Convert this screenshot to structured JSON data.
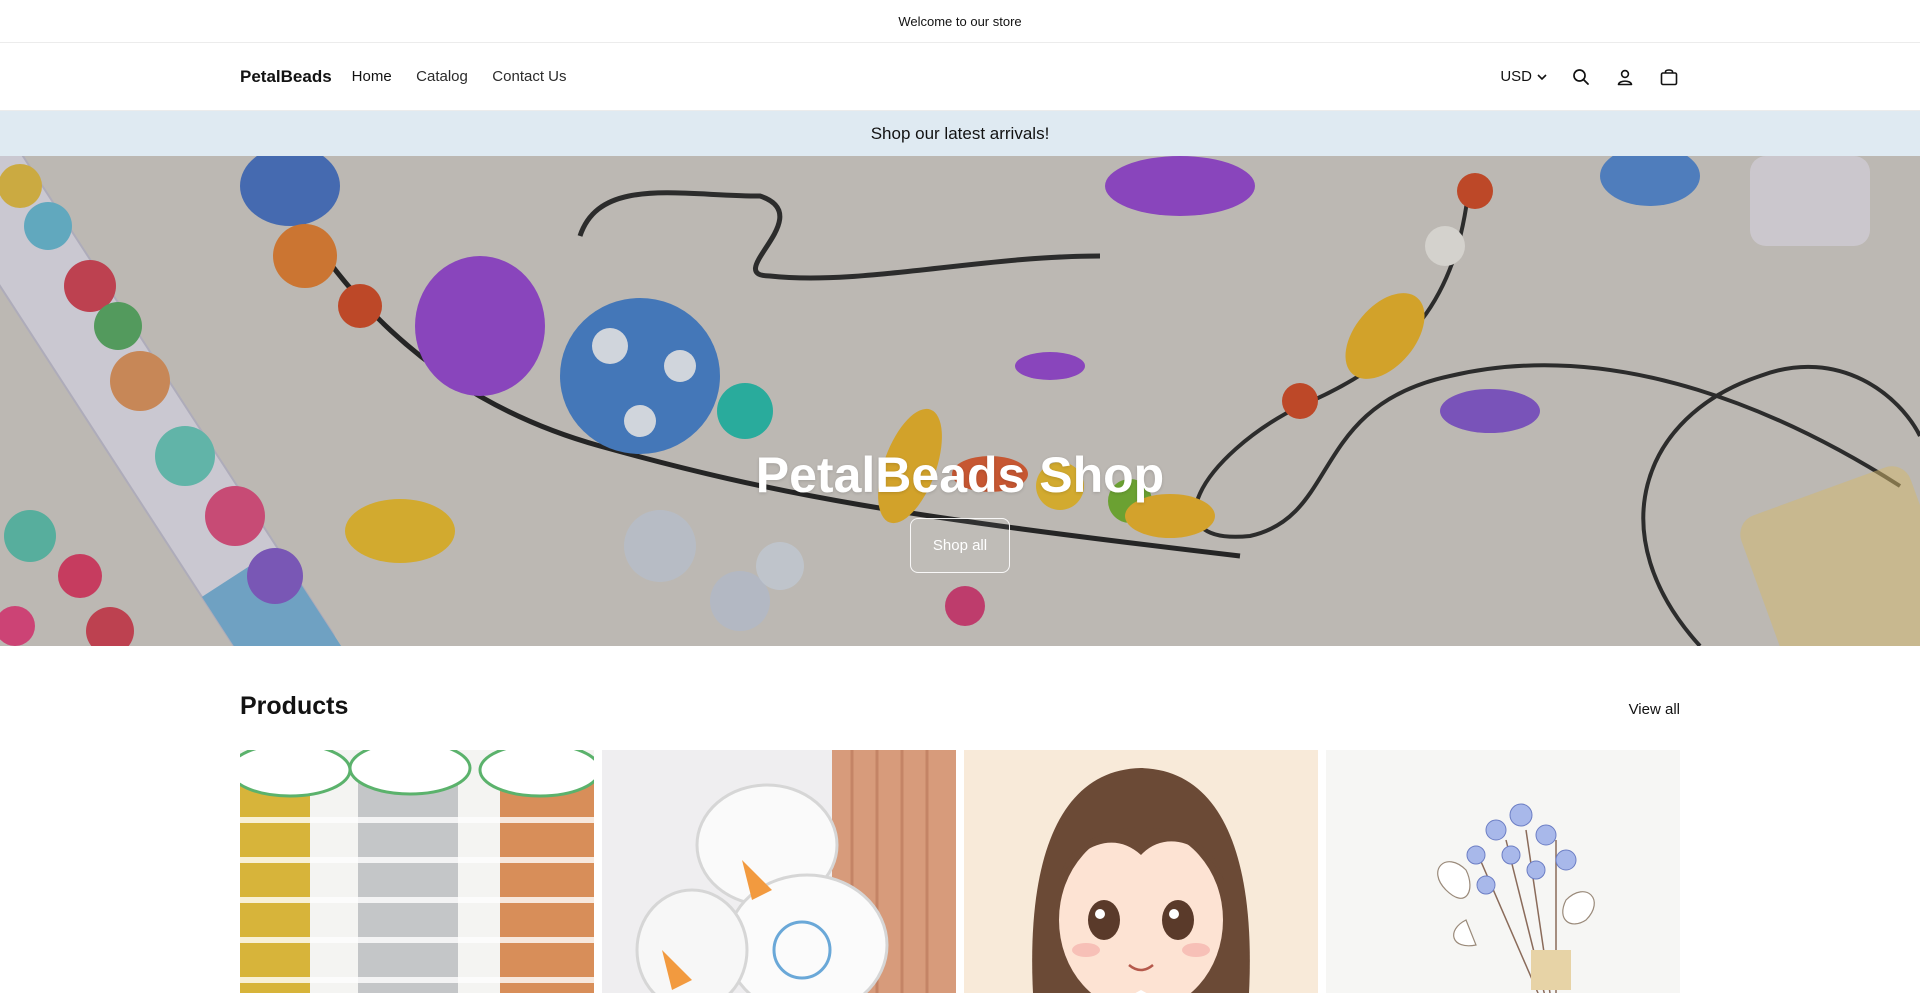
{
  "announcement": {
    "text": "Welcome to our store"
  },
  "header": {
    "logo": "PetalBeads",
    "nav": [
      "Home",
      "Catalog",
      "Contact Us"
    ],
    "currency": "USD",
    "icons": [
      "chevron-down-icon",
      "search-icon",
      "account-icon",
      "cart-icon"
    ]
  },
  "promo": {
    "text": "Shop our latest arrivals!"
  },
  "hero": {
    "title": "PetalBeads Shop",
    "button": "Shop all"
  },
  "products": {
    "title": "Products",
    "view_all": "View all",
    "items": [
      {
        "image": "metal wire spools"
      },
      {
        "image": "crystal elastic cord spools"
      },
      {
        "image": "anime girl illustration"
      },
      {
        "image": "flower bouquet illustration"
      }
    ]
  },
  "colors": {
    "promo_bg": "#dfeaf2",
    "text": "#121212",
    "border": "#ececec"
  }
}
